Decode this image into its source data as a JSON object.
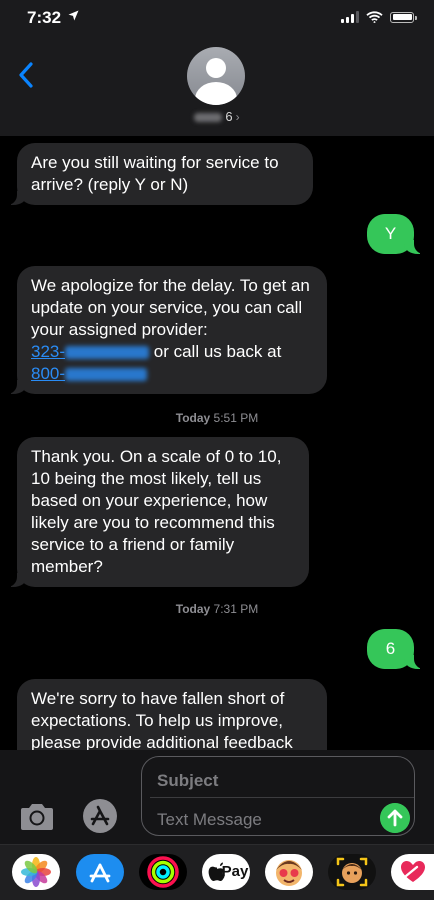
{
  "status_bar": {
    "time": "7:32"
  },
  "header": {
    "contact_suffix": "6",
    "chevron": "›"
  },
  "messages": [
    {
      "dir": "in",
      "text": "Are you still waiting for service to arrive? (reply Y or N)"
    },
    {
      "dir": "out",
      "text": "Y"
    },
    {
      "dir": "in",
      "text_parts": {
        "a": "We apologize for the delay. To get an update on your service, you can call your assigned provider:",
        "link1": "323-",
        "b": "or call us back at",
        "link2": "800-"
      }
    },
    {
      "type": "timestamp",
      "day": "Today",
      "time": "5:51 PM"
    },
    {
      "dir": "in",
      "text": "Thank you. On a scale of 0 to 10, 10 being the most likely, tell us based on your experience, how likely are you to recommend this service to a friend or family member?"
    },
    {
      "type": "timestamp",
      "day": "Today",
      "time": "7:31 PM"
    },
    {
      "dir": "out",
      "text": "6"
    },
    {
      "dir": "in",
      "text": "We're sorry to have fallen short of expectations. To help us improve, please provide additional feedback"
    }
  ],
  "composer": {
    "subject_placeholder": "Subject",
    "message_placeholder": "Text Message"
  },
  "app_drawer": {
    "items": [
      "photos-icon",
      "app-store-icon",
      "activity-icon",
      "apple-pay-icon",
      "memoji-icon",
      "animoji-icon",
      "digital-touch-icon"
    ],
    "apple_pay_label": "Pay"
  },
  "colors": {
    "sent_bubble": "#35c659",
    "received_bubble": "#262628",
    "link": "#2a8cf5",
    "accent": "#0a84ff"
  }
}
